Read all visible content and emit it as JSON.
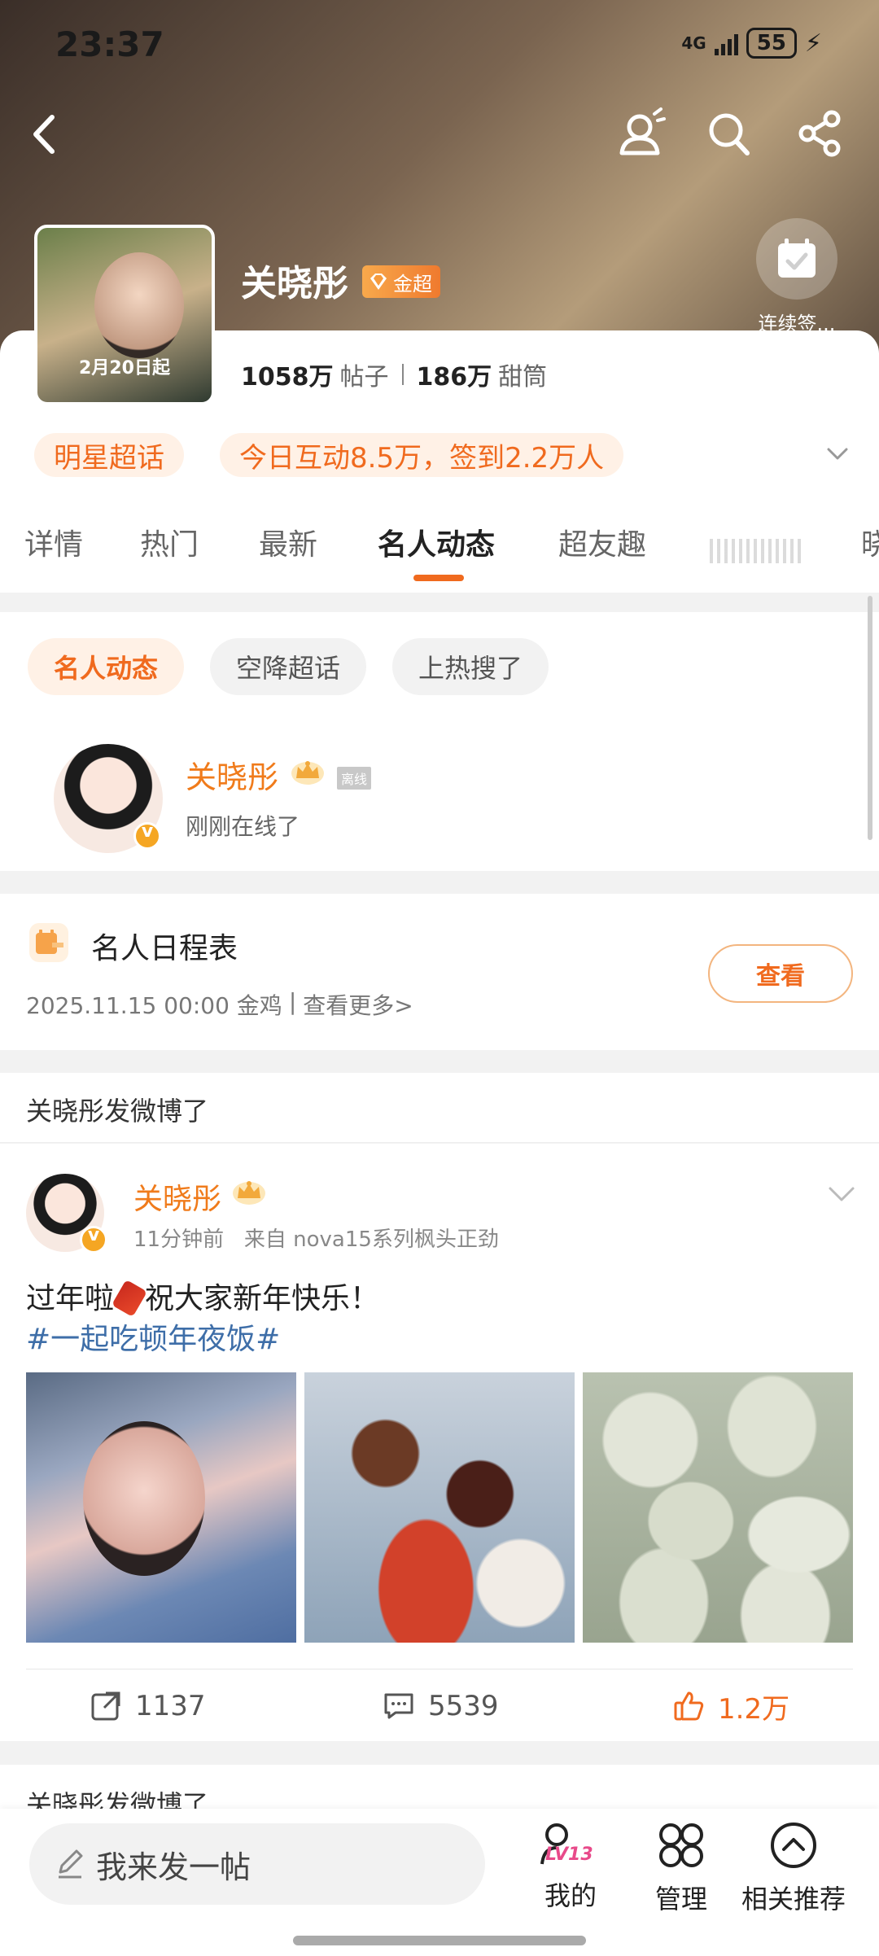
{
  "status_bar": {
    "time": "23:37",
    "network": "4G",
    "battery": "55"
  },
  "header": {
    "name": "关晓彤",
    "badge": "金超",
    "cover_date": "2月20日起",
    "checkin_label": "连续签..."
  },
  "stats": {
    "posts_count": "1058万",
    "posts_unit": "帖子",
    "fans_count": "186万",
    "fans_unit": "甜筒"
  },
  "chips": {
    "star_topic": "明星超话",
    "today": "今日互动8.5万，签到2.2万人"
  },
  "tabs": [
    "详情",
    "热门",
    "最新",
    "名人动态",
    "超友趣",
    "晓"
  ],
  "filters": [
    "名人动态",
    "空降超话",
    "上热搜了"
  ],
  "celebrity": {
    "name": "关晓彤",
    "offline_tag": "离线",
    "status": "刚刚在线了"
  },
  "schedule": {
    "title": "名人日程表",
    "date": "2025.11.15 00:00 金鸡",
    "separator": "|",
    "more": "查看更多>",
    "view_button": "查看"
  },
  "post_section": {
    "heading": "关晓彤发微博了"
  },
  "post": {
    "author": "关晓彤",
    "time": "11分钟前",
    "source": "来自 nova15系列枫头正劲",
    "text_before": "过年啦",
    "text_after": "祝大家新年快乐！",
    "hashtag": "#一起吃顿年夜饭#",
    "reposts": "1137",
    "comments": "5539",
    "likes": "1.2万"
  },
  "next_section": {
    "heading": "关晓彤发微博了"
  },
  "bottom_bar": {
    "compose_placeholder": "我来发一帖",
    "level": "LV13",
    "mine": "我的",
    "manage": "管理",
    "related": "相关推荐"
  },
  "colors": {
    "accent": "#f06a1e",
    "name_orange": "#f07b1b",
    "link_blue": "#3e6ea8"
  }
}
